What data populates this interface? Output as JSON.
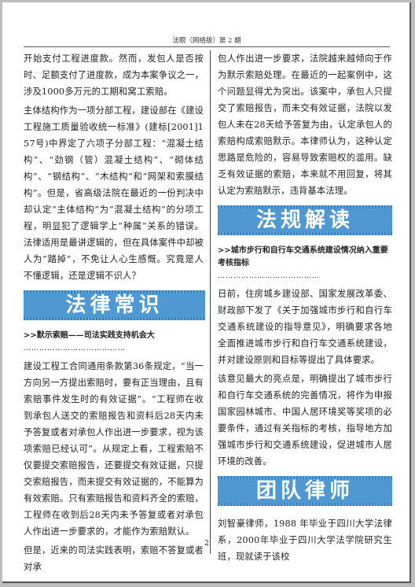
{
  "header": {
    "title": "法眼（网络版）第 2 期"
  },
  "left": {
    "p1": "开始支付工程进度款。然而，发包人是否按时、足额支付了进度款，成为本案争议之一，涉及1000多万元的工期和窝工索赔。",
    "p2": "主体结构作为一项分部工程，建设部在《建设工程施工质量验收统一标准》(建标[2001]157号)中界定了六项子分部工程：“混凝土结构”、“劲钢（管）混凝土结构”、“砌体结构”、“钢结构”、“木结构”和“网架和索膜结构”。但是，省高级法院在最近的一份判决中却认定“主体结构”为“混凝土结构”的分项工程，明显犯了逻辑学上“种属”关系的错误。法律适用是最讲逻辑的，但在具体案件中却被人为“踏掉”，不免让人心生感慨。究竟是人不懂逻辑，还是逻辑不识人？",
    "banner": "法律常识",
    "subhead": ">>默示索赔——司法实践支持机会大",
    "dots": "…………………………………",
    "p3": "建设工程工合同通用条款第36条规定，“当一方向另一方提出索赔时，要有正当理由，且有索赔事件发生时的有效证据”。“工程师在收到承包人送交的索赔报告和资料后28天内未予答复或者对承包人作出进一步要求，视为该项索赔已经认可”。从规定上看，工程索赔不仅要提交索赔报告，还要提交有效证据，只提交索赔报告，而未提交有效证据的，不能算为有效索赔。只有索赔报告和资料齐全的索赔，工程师在收到后28天内未予答复或者对承包人作出进一步要求的，才能作为索赔默认。",
    "p4": "但是，近来的司法实践表明，索赔不答复或者对承"
  },
  "right": {
    "p1": "包人作出进一步要求，法院越来越倾向于作为默示索赔处理。在最近的一起案例中，这个问题显得尤为突出。该案中，承包人只提交了索赔报告，而未交有效证据，法院以发包人未在28天给予答复为由，认定承包人的索赔构成索赔默示。本律师认为，这种认定思路是危险的，容易导致索赔权的滥用。缺乏有效证据的索赔，本来就不用回复，将其认定为索赔默示，违背基本法理。",
    "banner": "法规解读",
    "subhead": ">>城市步行和自行车交通系统建设情况纳入重要考核指标",
    "dots": "…………………………………",
    "p2": "日前，住房城乡建设部、国家发展改革委、财政部下发了《关于加强城市步行和自行车交通系统建设的指导意见》，明确要求各地全面推进城市步行和自行车交通系统建设，并对建设原则和目标等提出了具体要求。",
    "p3": "该意见最大的亮点是，明确提出了城市步行和自行车交通系统的完善情况，将作为申报国家园林城市、中国人居环境奖等奖项的必要条件，通过有关指标的考核，指导地方加强城市步行和交通系统建设，促进城市人居环境的改善。",
    "banner2": "团队律师",
    "p4": "刘智豪律师，1988 年毕业于四川大学法律系，2000年毕业于四川大学法学院研究生班，现就读于该校"
  },
  "footer": {
    "page_number": "2"
  }
}
